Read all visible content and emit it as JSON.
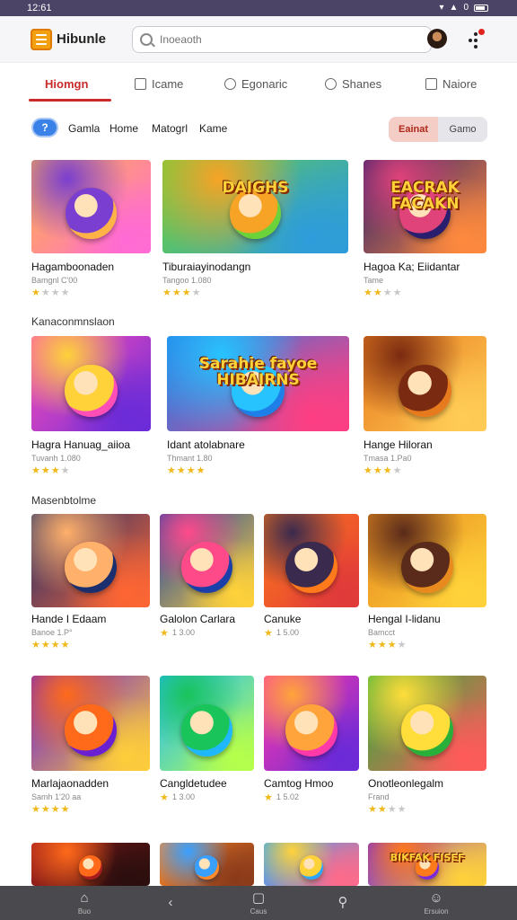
{
  "status_bar": {
    "time": "12:61",
    "battery": "0"
  },
  "header": {
    "app_name": "Hibunle",
    "search_placeholder": "Inoeaoth"
  },
  "tabs": [
    {
      "label": "Hiomgn",
      "icon": "home-icon",
      "active": true
    },
    {
      "label": "Icame",
      "icon": "square-icon",
      "active": false
    },
    {
      "label": "Egonaric",
      "icon": "chat-icon",
      "active": false
    },
    {
      "label": "Shanes",
      "icon": "smile-icon",
      "active": false
    },
    {
      "label": "Naiore",
      "icon": "bookmark-icon",
      "active": false
    }
  ],
  "filters": {
    "chip": "?",
    "items": [
      "Gamla",
      "Home",
      "Matogrl",
      "Kame"
    ],
    "segment": [
      "Eainat",
      "Gamo"
    ]
  },
  "sections": [
    {
      "title": ""
    },
    {
      "title": "Kanaconmnslaon"
    },
    {
      "title": "Masenbtolme"
    }
  ],
  "games": [
    {
      "title": "Hagamboonaden",
      "sub": "Bamgnl C'00",
      "rating": 1.5,
      "colors": [
        "#ffb347",
        "#7a3fd0",
        "#ff6ad5"
      ],
      "banner": ""
    },
    {
      "title": "Tiburaiayinodangn",
      "sub": "Tangoo 1.080",
      "rating": 3,
      "colors": [
        "#6bd23a",
        "#f7a325",
        "#2d9cdb"
      ],
      "banner": "DAIGHS"
    },
    {
      "title": "Hagoa Ka; Eiidantar",
      "sub": "Tame",
      "rating": 2.5,
      "colors": [
        "#2a1e6e",
        "#e0427a",
        "#ff8a3d"
      ],
      "banner": "EACRAK FACAKN"
    },
    {
      "title": "Hagra Hanuag_aiioa",
      "sub": "Tuvanh 1.080",
      "rating": 3,
      "colors": [
        "#ff4fb7",
        "#ffd23a",
        "#6a2bd8"
      ],
      "banner": ""
    },
    {
      "title": "Idant atolabnare",
      "sub": "Thmant 1.80",
      "rating": 4,
      "colors": [
        "#1e7fe8",
        "#26c3ff",
        "#ff3e82"
      ],
      "banner": "Sarahie fayoe HIBAIRNS"
    },
    {
      "title": "Hange Hiloran",
      "sub": "Tmasa 1.Pa0",
      "rating": 3,
      "colors": [
        "#e87a1e",
        "#7a2a10",
        "#ffcc55"
      ],
      "banner": ""
    },
    {
      "title": "Hande I Edaam",
      "sub": "Banoe 1.P°",
      "rating": 4,
      "colors": [
        "#1b2e6e",
        "#ffb06a",
        "#ff6633"
      ],
      "banner": ""
    },
    {
      "title": "Galolon Carlara",
      "sub": "1 3.00",
      "rating": 1,
      "colors": [
        "#1a3fa8",
        "#ff4a8a",
        "#ffd23a"
      ],
      "banner": ""
    },
    {
      "title": "Canuke",
      "sub": "1 5.00",
      "rating": 1,
      "colors": [
        "#ff7a1a",
        "#3a2a4e",
        "#e03a3a"
      ],
      "banner": ""
    },
    {
      "title": "Hengal I-lidanu",
      "sub": "Bamcct",
      "rating": 3.5,
      "colors": [
        "#e88a1e",
        "#5a2a1a",
        "#ffd23a"
      ],
      "banner": ""
    },
    {
      "title": "Marlajaonadden",
      "sub": "Samh 1'20 aa",
      "rating": 4,
      "colors": [
        "#6a1fd0",
        "#ff6a1a",
        "#ffce3a"
      ],
      "banner": ""
    },
    {
      "title": "Cangldetudee",
      "sub": "1 3.00",
      "rating": 1,
      "colors": [
        "#1fb8ff",
        "#19c45a",
        "#b6ff4a"
      ],
      "banner": ""
    },
    {
      "title": "Camtog Hmoo",
      "sub": "1 5.02",
      "rating": 1,
      "colors": [
        "#ff3aa8",
        "#ffa43a",
        "#6a2ad8"
      ],
      "banner": ""
    },
    {
      "title": "Onotleonlegalm",
      "sub": "Frand",
      "rating": 2.5,
      "colors": [
        "#28b03a",
        "#ffdd3a",
        "#ff5a5a"
      ],
      "banner": ""
    },
    {
      "title": "",
      "sub": "",
      "rating": 0,
      "colors": [
        "#a81e1e",
        "#ff6a1a",
        "#2a0e0e"
      ],
      "banner": ""
    },
    {
      "title": "",
      "sub": "",
      "rating": 0,
      "colors": [
        "#ff8a2a",
        "#3aa0ff",
        "#8a3a1a"
      ],
      "banner": ""
    },
    {
      "title": "",
      "sub": "",
      "rating": 0,
      "colors": [
        "#2aa8ff",
        "#ffd23a",
        "#ff6a8a"
      ],
      "banner": ""
    },
    {
      "title": "",
      "sub": "",
      "rating": 0,
      "colors": [
        "#7a2ad8",
        "#ff7a1a",
        "#ffd23a"
      ],
      "banner": "BIKFAK FISEF"
    }
  ],
  "bottom_nav": [
    {
      "label": "Buo",
      "icon": "home-icon"
    },
    {
      "label": "",
      "icon": "back-icon"
    },
    {
      "label": "Caus",
      "icon": "square-icon"
    },
    {
      "label": "",
      "icon": "search-icon"
    },
    {
      "label": "Ersuion",
      "icon": "profile-icon"
    }
  ]
}
